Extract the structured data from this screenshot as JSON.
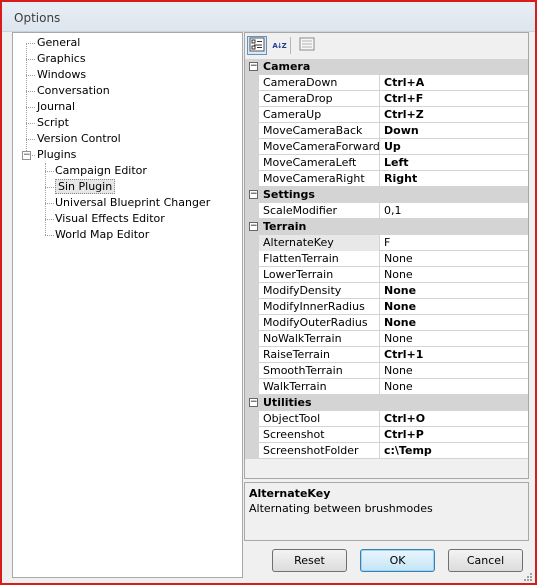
{
  "window": {
    "title": "Options"
  },
  "tree": {
    "items": [
      {
        "label": "General"
      },
      {
        "label": "Graphics"
      },
      {
        "label": "Windows"
      },
      {
        "label": "Conversation"
      },
      {
        "label": "Journal"
      },
      {
        "label": "Script"
      },
      {
        "label": "Version Control"
      },
      {
        "label": "Plugins",
        "expander": "−"
      }
    ],
    "plugins": [
      {
        "label": "Campaign Editor"
      },
      {
        "label": "Sin Plugin"
      },
      {
        "label": "Universal Blueprint Changer"
      },
      {
        "label": "Visual Effects Editor"
      },
      {
        "label": "World Map Editor"
      }
    ],
    "selected": "Sin Plugin"
  },
  "toolbar": {
    "categorized_icon": "categorized-icon",
    "alphabetical_icon": "alphabetical-sort-icon",
    "alphabetical_glyph": "A↓Z",
    "property_pages_icon": "property-pages-icon"
  },
  "grid": {
    "categories": [
      {
        "name": "Camera",
        "expander": "−",
        "props": [
          {
            "name": "CameraDown",
            "value": "Ctrl+A",
            "bold": true
          },
          {
            "name": "CameraDrop",
            "value": "Ctrl+F",
            "bold": true
          },
          {
            "name": "CameraUp",
            "value": "Ctrl+Z",
            "bold": true
          },
          {
            "name": "MoveCameraBack",
            "value": "Down",
            "bold": true
          },
          {
            "name": "MoveCameraForward",
            "value": "Up",
            "bold": true
          },
          {
            "name": "MoveCameraLeft",
            "value": "Left",
            "bold": true
          },
          {
            "name": "MoveCameraRight",
            "value": "Right",
            "bold": true
          }
        ]
      },
      {
        "name": "Settings",
        "expander": "−",
        "props": [
          {
            "name": "ScaleModifier",
            "value": "0,1",
            "bold": false
          }
        ]
      },
      {
        "name": "Terrain",
        "expander": "−",
        "props": [
          {
            "name": "AlternateKey",
            "value": "F",
            "bold": false,
            "selected": true
          },
          {
            "name": "FlattenTerrain",
            "value": "None",
            "bold": false
          },
          {
            "name": "LowerTerrain",
            "value": "None",
            "bold": false
          },
          {
            "name": "ModifyDensity",
            "value": "None",
            "bold": true
          },
          {
            "name": "ModifyInnerRadius",
            "value": "None",
            "bold": true
          },
          {
            "name": "ModifyOuterRadius",
            "value": "None",
            "bold": true
          },
          {
            "name": "NoWalkTerrain",
            "value": "None",
            "bold": false
          },
          {
            "name": "RaiseTerrain",
            "value": "Ctrl+1",
            "bold": true
          },
          {
            "name": "SmoothTerrain",
            "value": "None",
            "bold": false
          },
          {
            "name": "WalkTerrain",
            "value": "None",
            "bold": false
          }
        ]
      },
      {
        "name": "Utilities",
        "expander": "−",
        "props": [
          {
            "name": "ObjectTool",
            "value": "Ctrl+O",
            "bold": true
          },
          {
            "name": "Screenshot",
            "value": "Ctrl+P",
            "bold": true
          },
          {
            "name": "ScreenshotFolder",
            "value": "c:\\Temp",
            "bold": true
          }
        ]
      }
    ]
  },
  "description": {
    "title": "AlternateKey",
    "text": "Alternating between brushmodes"
  },
  "buttons": {
    "reset": "Reset",
    "ok": "OK",
    "cancel": "Cancel"
  },
  "colors": {
    "window_border": "#d81c1c",
    "category_bg": "#d4d4d4",
    "default_button_border": "#3c7fb1"
  }
}
